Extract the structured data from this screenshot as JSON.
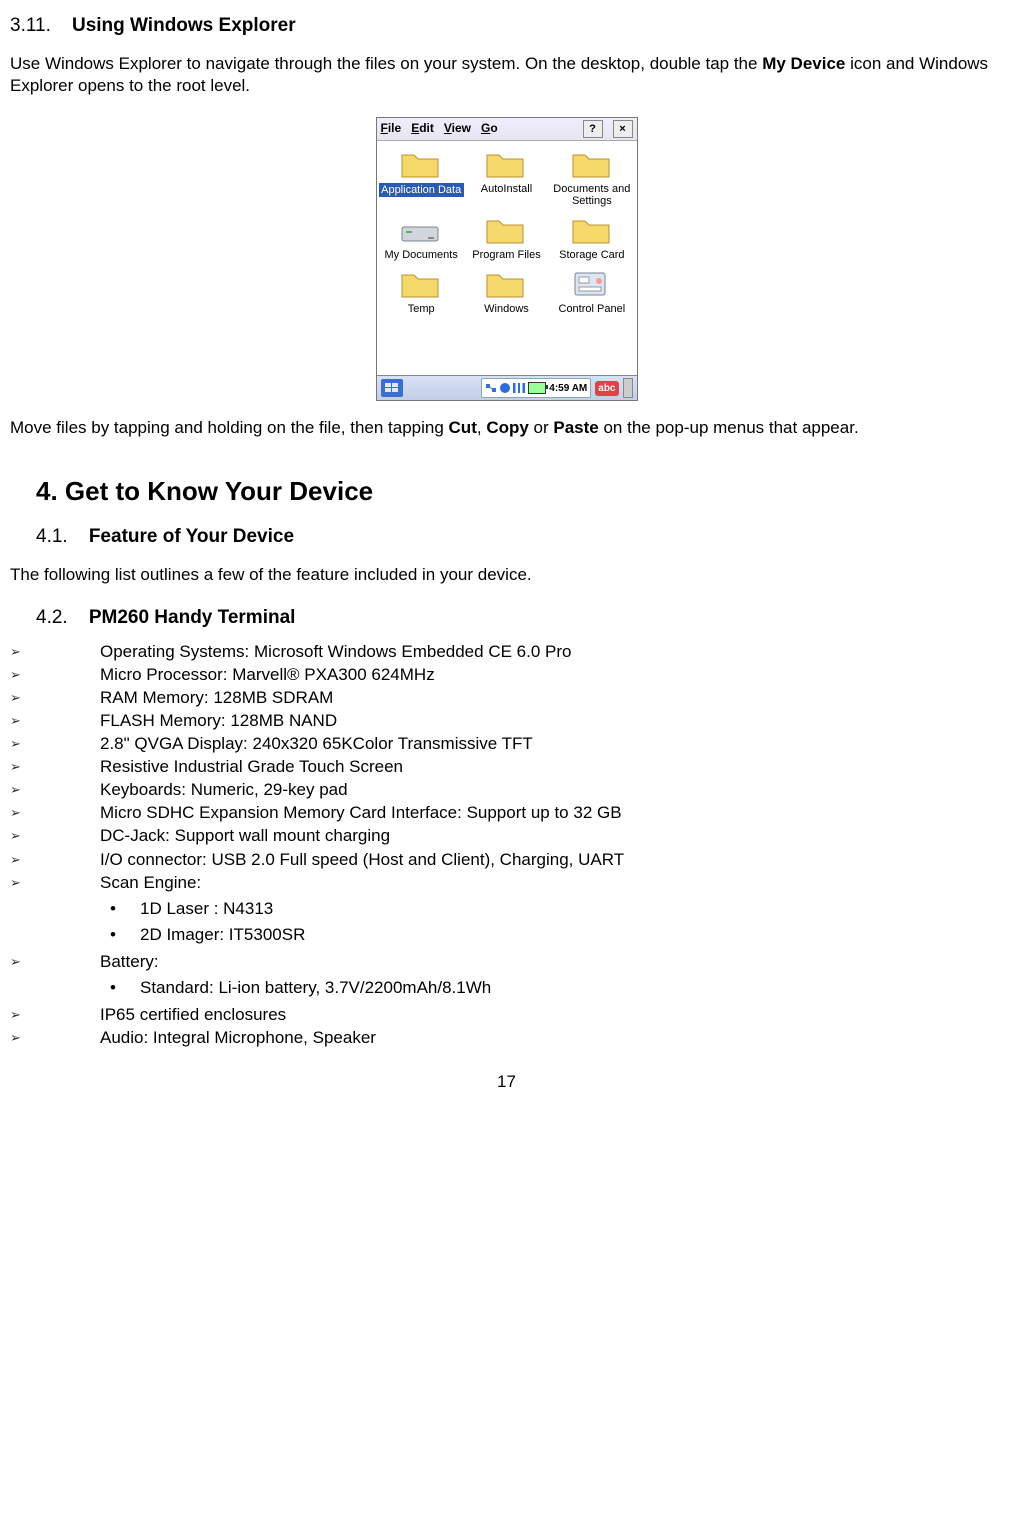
{
  "section311": {
    "num": "3.11.",
    "title": "Using Windows Explorer"
  },
  "para1_a": "Use Windows Explorer to navigate through the files on your system. On the desktop, double tap the ",
  "para1_b": "My Device",
  "para1_c": " icon and Windows Explorer opens to the root level.",
  "explorer": {
    "menu": {
      "file": "File",
      "edit": "Edit",
      "view": "View",
      "go": "Go",
      "help": "?",
      "close": "×"
    },
    "items": [
      {
        "name": "Application Data",
        "type": "folder",
        "selected": true
      },
      {
        "name": "AutoInstall",
        "type": "folder"
      },
      {
        "name": "Documents and Settings",
        "type": "folder"
      },
      {
        "name": "My Documents",
        "type": "drive"
      },
      {
        "name": "Program Files",
        "type": "folder"
      },
      {
        "name": "Storage Card",
        "type": "folder"
      },
      {
        "name": "Temp",
        "type": "folder"
      },
      {
        "name": "Windows",
        "type": "folder"
      },
      {
        "name": "Control Panel",
        "type": "cpl"
      }
    ],
    "taskbar": {
      "time": "4:59 AM",
      "sip": "abc"
    }
  },
  "para2_a": "Move files by tapping and holding on the file, then tapping ",
  "para2_cut": "Cut",
  "para2_sep1": ", ",
  "para2_copy": "Copy",
  "para2_sep2": " or ",
  "para2_paste": "Paste",
  "para2_b": " on the pop-up menus that appear.",
  "chapter4": "4. Get to Know Your Device",
  "section41": {
    "num": "4.1.",
    "title": "Feature of Your Device"
  },
  "para3": "The following list outlines a few of the feature included in your device.",
  "section42": {
    "num": "4.2.",
    "title": "PM260 Handy Terminal"
  },
  "specs": [
    "Operating Systems: Microsoft Windows Embedded CE 6.0 Pro",
    "Micro Processor: Marvell® PXA300 624MHz",
    "RAM Memory: 128MB SDRAM",
    "FLASH Memory: 128MB NAND",
    "2.8\" QVGA Display: 240x320 65KColor Transmissive TFT",
    "Resistive Industrial Grade Touch Screen",
    "Keyboards: Numeric, 29-key pad",
    "Micro SDHC Expansion Memory Card Interface: Support up to 32 GB",
    "DC-Jack: Support wall mount charging",
    "I/O connector: USB 2.0 Full speed (Host and Client), Charging, UART"
  ],
  "scan": {
    "head": "Scan Engine:",
    "items": [
      "1D Laser : N4313",
      "2D Imager: IT5300SR"
    ]
  },
  "battery": {
    "head": "Battery:",
    "items": [
      "Standard: Li-ion battery, 3.7V/2200mAh/8.1Wh"
    ]
  },
  "specs_tail": [
    "IP65 certified enclosures",
    "Audio: Integral Microphone, Speaker"
  ],
  "page": "17"
}
